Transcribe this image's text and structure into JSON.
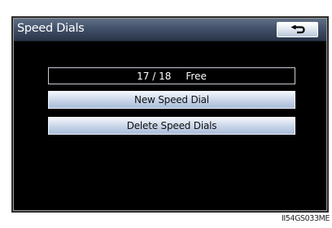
{
  "header": {
    "title": "Speed Dials",
    "back_icon": "return-arrow-icon"
  },
  "status": {
    "count": "17 / 18",
    "label": "Free"
  },
  "menu": {
    "items": [
      {
        "label": "New Speed Dial"
      },
      {
        "label": "Delete Speed Dials"
      }
    ]
  },
  "caption": "II54GS033ME"
}
